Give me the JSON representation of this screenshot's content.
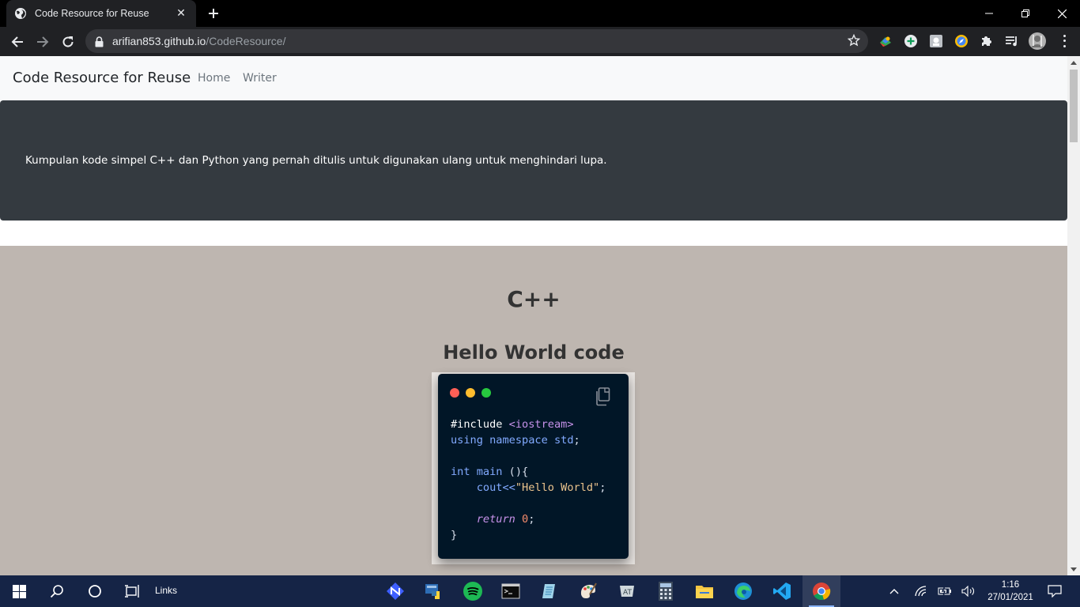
{
  "browser": {
    "tab_title": "Code Resource for Reuse",
    "tab_close_glyph": "✕",
    "url_host": "arifian853.github.io",
    "url_path": "/CodeResource/",
    "extension_icons": [
      "google-earth-icon",
      "add-circle-icon",
      "extension-square-icon",
      "compass-icon",
      "puzzle-icon",
      "media-queue-icon",
      "profile-avatar"
    ]
  },
  "site": {
    "brand": "Code Resource for Reuse",
    "nav": [
      "Home",
      "Writer"
    ],
    "tagline": "Kumpulan kode simpel C++ dan Python yang pernah ditulis untuk digunakan ulang untuk menghindari lupa.",
    "section_title": "C++",
    "snippet_title": "Hello World code",
    "code_lines": [
      [
        {
          "t": "#include ",
          "c": "pp"
        },
        {
          "t": "<iostream>",
          "c": "inc"
        }
      ],
      [
        {
          "t": "using namespace std",
          "c": "kw"
        },
        {
          "t": ";",
          "c": "pl"
        }
      ],
      [],
      [
        {
          "t": "int main ",
          "c": "kw"
        },
        {
          "t": "(){",
          "c": "pl"
        }
      ],
      [
        {
          "t": "    cout<<",
          "c": "kw"
        },
        {
          "t": "\"Hello World\"",
          "c": "str"
        },
        {
          "t": ";",
          "c": "pl"
        }
      ],
      [],
      [
        {
          "t": "    ",
          "c": "pl"
        },
        {
          "t": "return",
          "c": "ret"
        },
        {
          "t": " ",
          "c": "pl"
        },
        {
          "t": "0",
          "c": "num"
        },
        {
          "t": ";",
          "c": "pl"
        }
      ],
      [
        {
          "t": "}",
          "c": "pl"
        }
      ]
    ],
    "window_dots": [
      "#ff5f56",
      "#ffbd2e",
      "#27c93f"
    ]
  },
  "taskbar": {
    "links_label": "Links",
    "time": "1:16",
    "date": "27/01/2021",
    "apps": [
      "nordvpn-icon",
      "python-icon",
      "spotify-icon",
      "terminal-icon",
      "notepad-icon",
      "paint-icon",
      "typora-icon",
      "calculator-icon",
      "file-explorer-icon",
      "edge-icon",
      "vscode-icon",
      "chrome-icon"
    ]
  }
}
